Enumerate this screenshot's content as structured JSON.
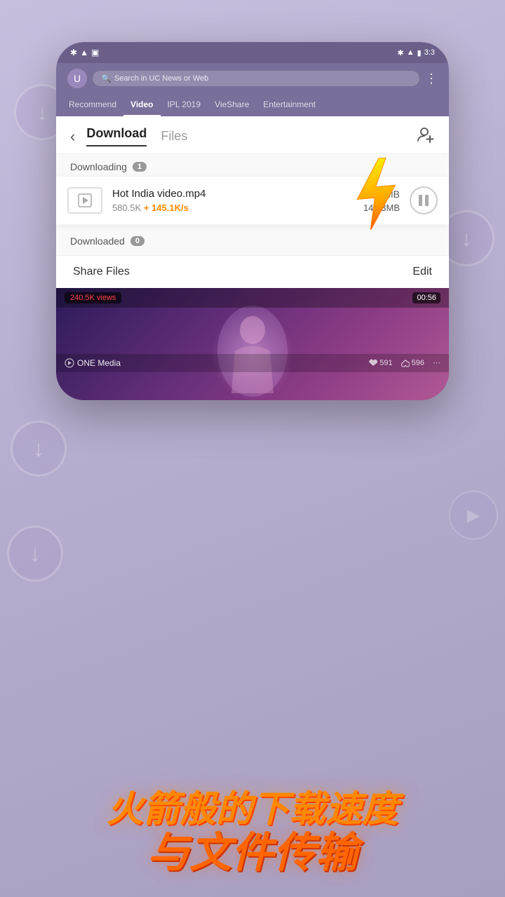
{
  "background": {
    "color": "#c8bede"
  },
  "status_bar": {
    "time": "3:3",
    "icons": [
      "bluetooth",
      "wifi",
      "battery"
    ]
  },
  "browser_bar": {
    "search_placeholder": "Search in UC News or Web"
  },
  "nav_tabs": {
    "items": [
      {
        "label": "Recommend",
        "active": false
      },
      {
        "label": "Video",
        "active": true
      },
      {
        "label": "IPL 2019",
        "active": false
      },
      {
        "label": "VieShare",
        "active": false
      },
      {
        "label": "Entertainment",
        "active": false
      }
    ]
  },
  "download_panel": {
    "back_label": "‹",
    "tab_download": "Download",
    "tab_files": "Files",
    "add_user_label": "🧑+"
  },
  "downloading_section": {
    "label": "Downloading",
    "count": "1",
    "item": {
      "name": "Hot India video.mp4",
      "total_size": "15.60MB",
      "speed_base": "580.5K",
      "speed_delta": "+ 145.1K/s",
      "downloaded": "14.53MB",
      "pause_icon": "⏸"
    }
  },
  "downloaded_section": {
    "label": "Downloaded",
    "count": "0"
  },
  "bottom_bar": {
    "share_files": "Share Files",
    "edit": "Edit"
  },
  "video_content": {
    "views": "240.5K views",
    "duration": "00:56",
    "artist": "ONE Media",
    "like_count": "591",
    "dislike_count": "596",
    "menu_icon": "···"
  },
  "bottom_text": {
    "line1": "火箭般的下载速度",
    "line2": "与文件传输"
  }
}
